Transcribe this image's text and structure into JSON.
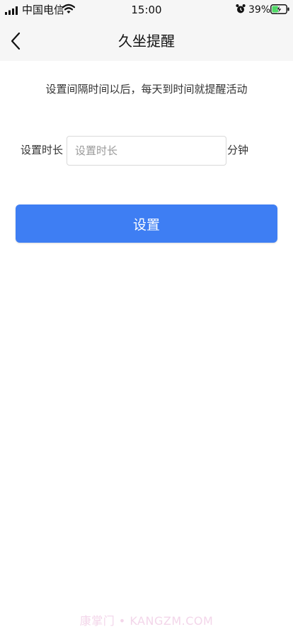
{
  "status_bar": {
    "carrier": "中国电信",
    "time": "15:00",
    "battery_percent": "39%",
    "icons": [
      "signal-icon",
      "wifi-icon",
      "alarm-icon",
      "battery-charging-icon"
    ]
  },
  "nav": {
    "title": "久坐提醒",
    "back_icon": "chevron-left-icon"
  },
  "content": {
    "description": "设置间隔时间以后，每天到时间就提醒活动",
    "duration_label": "设置时长",
    "duration_value": "",
    "duration_placeholder": "设置时长",
    "unit": "分钟",
    "submit_label": "设置"
  },
  "watermark": "康掌门 • KANGZM.COM",
  "colors": {
    "accent": "#3e7ef3",
    "navbar_bg": "#f6f6f6",
    "battery_green": "#4cd964"
  }
}
